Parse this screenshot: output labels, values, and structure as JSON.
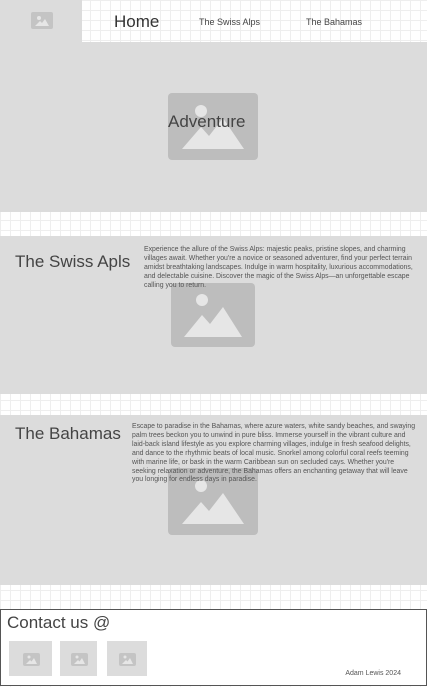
{
  "nav": {
    "home": "Home",
    "links": [
      "The Swiss Alps",
      "The Bahamas"
    ],
    "logo_icon": "image-placeholder-icon"
  },
  "hero": {
    "title": "Adventure",
    "image_icon": "image-placeholder-icon"
  },
  "sections": [
    {
      "title": "The Swiss Apls",
      "text": "Experience the allure of the Swiss Alps: majestic peaks, pristine slopes, and charming villages await. Whether you're a novice or seasoned adventurer, find your perfect terrain amidst breathtaking landscapes. Indulge in warm hospitality, luxurious accommodations, and delectable cuisine. Discover the magic of the Swiss Alps—an unforgettable escape calling you to return.",
      "image_icon": "image-placeholder-icon"
    },
    {
      "title": "The Bahamas",
      "text": "Escape to paradise in the Bahamas, where azure waters, white sandy beaches, and swaying palm trees beckon you to unwind in pure bliss. Immerse yourself in the vibrant culture and laid-back island lifestyle as you explore charming villages, indulge in fresh seafood delights, and dance to the rhythmic beats of local music. Snorkel among colorful coral reefs teeming with marine life, or bask in the warm Caribbean sun on secluded cays. Whether you're seeking relaxation or adventure, the Bahamas offers an enchanting getaway that will leave you longing for endless days in paradise.",
      "image_icon": "image-placeholder-icon"
    }
  ],
  "footer": {
    "contact": "Contact us @",
    "credit": "Adam Lewis 2024",
    "social_icons": [
      "image-placeholder-icon",
      "image-placeholder-icon",
      "image-placeholder-icon"
    ]
  },
  "colors": {
    "panel": "#dcdcdc",
    "placeholder": "#bdbdbd",
    "text": "#444444"
  }
}
